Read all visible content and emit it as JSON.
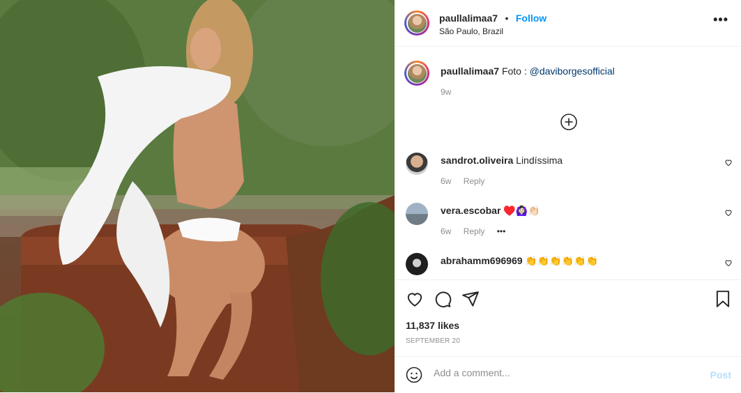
{
  "post": {
    "username": "paullalimaa7",
    "separator": "•",
    "follow_label": "Follow",
    "location": "São Paulo, Brazil",
    "more_icon": "more-icon"
  },
  "caption": {
    "username": "paullalimaa7",
    "text": "Foto :",
    "mention": "@daviborgesofficial",
    "time": "9w"
  },
  "comments": [
    {
      "username": "sandrot.oliveira",
      "text": "Lindíssima",
      "time": "6w",
      "reply": "Reply"
    },
    {
      "username": "vera.escobar",
      "text": "♥️🙆🏻‍♀️👏🏻",
      "time": "6w",
      "reply": "Reply",
      "more": "•••"
    },
    {
      "username": "abrahamm696969",
      "text": "👏👏👏👏👏👏"
    }
  ],
  "likes": "11,837 likes",
  "date": "SEPTEMBER 20",
  "add_comment": {
    "placeholder": "Add a comment...",
    "post_label": "Post"
  },
  "colors": {
    "follow": "#0095f6",
    "post_disabled": "#b2dffc",
    "meta": "#8e8e8e"
  }
}
